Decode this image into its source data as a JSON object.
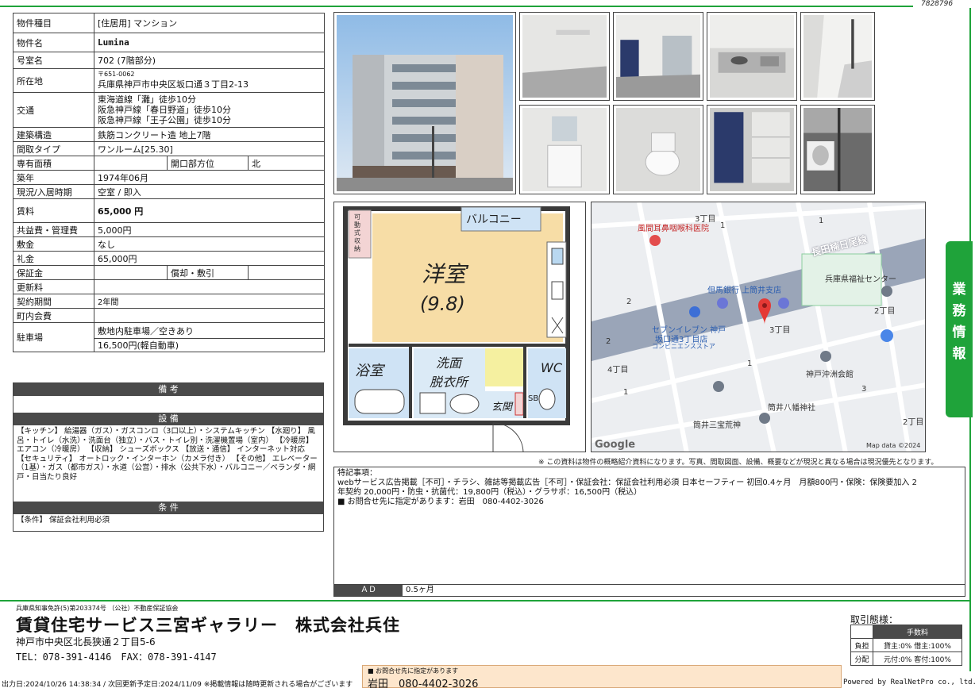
{
  "doc_id": "7828796",
  "property": {
    "type_label": "物件種目",
    "type_value": "[住居用] マンション",
    "name_label": "物件名",
    "name_value": "Lumina",
    "room_label": "号室名",
    "room_value": "702 (7階部分)",
    "address_label": "所在地",
    "postal": "〒651-0062",
    "address_value": "兵庫県神戸市中央区坂口通３丁目2-13",
    "access_label": "交通",
    "access": [
      "東海道線「灘」徒歩10分",
      "阪急神戸線「春日野道」徒歩10分",
      "阪急神戸線「王子公園」徒歩10分"
    ],
    "structure_label": "建築構造",
    "structure_value": "鉄筋コンクリート造 地上7階",
    "layout_label": "間取タイプ",
    "layout_value": "ワンルーム[25.30]",
    "area_label": "専有面積",
    "area_value": "",
    "facing_label": "開口部方位",
    "facing_value": "北",
    "built_label": "築年",
    "built_value": "1974年06月",
    "status_label": "現況/入居時期",
    "status_value": "空室 / 即入",
    "rent_label": "賃料",
    "rent_value": "65,000 円",
    "fee_label": "共益費・管理費",
    "fee_value": "5,000円",
    "deposit_label": "敷金",
    "deposit_value": "なし",
    "key_money_label": "礼金",
    "key_money_value": "65,000円",
    "guarantee_label": "保証金",
    "guarantee_value": "",
    "amort_label": "償却・敷引",
    "amort_value": "",
    "renewal_label": "更新料",
    "renewal_value": "",
    "contract_label": "契約期間",
    "contract_value": "2年間",
    "community_label": "町内会費",
    "community_value": "",
    "parking_label": "駐車場",
    "parking_value_1": "敷地内駐車場／空きあり",
    "parking_value_2": "16,500円(軽自動車)"
  },
  "remarks": {
    "bikou_header": "備 考",
    "bikou_body": "",
    "setsubi_header": "設 備",
    "setsubi_body": "【キッチン】 給湯器（ガス）・ガスコンロ（3口以上）・システムキッチン 【水廻り】 風呂・トイレ（水洗）・洗面台（独立）・バス・トイレ別・洗濯機置場（室内） 【冷暖房】 エアコン（冷暖房） 【収納】 シューズボックス 【放送・通信】 インターネット対応 【セキュリティ】 オートロック・インターホン（カメラ付き） 【その他】 エレベーター（1基）・ガス（都市ガス）・水道（公営）・排水（公共下水）・バルコニー／ベランダ・網戸・日当たり良好",
    "joken_header": "条 件",
    "joken_body": "【条件】 保証会社利用必須"
  },
  "floor_plan": {
    "balcony": "バルコニー",
    "storage": [
      "可",
      "動",
      "式",
      "収",
      "納"
    ],
    "room": "洋室",
    "room_size": "(9.8)",
    "bath": "浴室",
    "washroom_1": "洗面",
    "washroom_2": "脱衣所",
    "wc": "WC",
    "entrance": "玄関",
    "sb": "SB"
  },
  "map": {
    "labels": {
      "l1": "3丁目",
      "l2": "風間耳鼻咽喉科医院",
      "l3": "1",
      "l4": "1",
      "l5": "長田楠日尾線",
      "l6": "兵庫県福祉センター",
      "l7": "但馬銀行 上筒井支店",
      "l8": "2丁目",
      "l9": "2",
      "l10": "セブンイレブン 神戸",
      "l11": "坂口通3丁目店",
      "l12": "コンビニエンスストア",
      "l13": "3丁目",
      "l14": "2",
      "l15": "4丁目",
      "l16": "1",
      "l17": "神戸沖洲会館",
      "l18": "1",
      "l19": "3",
      "l20": "筒井八幡神社",
      "l21": "筒井三宝荒神",
      "l22": "2丁目"
    },
    "google": "Google",
    "map_data": "Map data ©2024"
  },
  "disclaimer": "※ この資料は物件の概略紹介資料になります。写真、間取図面、設備、概要などが現況と異なる場合は現況優先となります。",
  "notes": {
    "title": "特記事項：",
    "line1": "webサービス広告掲載［不可］・チラシ、雑誌等掲載広告［不可］・保証会社：保証会社利用必須 日本セーフティー 初回0.4ヶ月　月額800円・保険：保険要加入 2",
    "line2": "年契約 20,000円・防虫・抗菌代：19,800円（税込）・グラサポ：16,500円（税込）",
    "line3": "■ お問合せ先に指定があります：岩田　080-4402-3026",
    "ad_label": "ＡＤ",
    "ad_value": "0.5ヶ月"
  },
  "side_tab": [
    "業",
    "務",
    "情",
    "報"
  ],
  "footer": {
    "license": "兵庫県知事免許(5)第203374号 （公社）不動産保証協会",
    "company": "賃貸住宅サービス三宮ギャラリー　株式会社兵住",
    "address": "神戸市中央区北長狭通２丁目5-6",
    "telfax": "TEL：078-391-4146　FAX：078-391-4147",
    "printed": "出力日:2024/10/26 14:38:34 / 次回更新予定日:2024/11/09 ※掲載情報は随時更新される場合がございます",
    "contact_note": "■ お問合せ先に指定があります",
    "contact_value": "岩田　080-4402-3026",
    "deal_label": "取引態様：",
    "fee_header": "手数料",
    "futan_label": "負担",
    "futan_value": "貸主:0% 借主:100%",
    "haibun_label": "分配",
    "haibun_value": "元付:0% 客付:100%",
    "powered": "Powered by RealNetPro co., ltd."
  },
  "colors": {
    "accent_green": "#1fa33a",
    "header_dark": "#4a4a4a",
    "contact_bg": "#fde6cc"
  }
}
